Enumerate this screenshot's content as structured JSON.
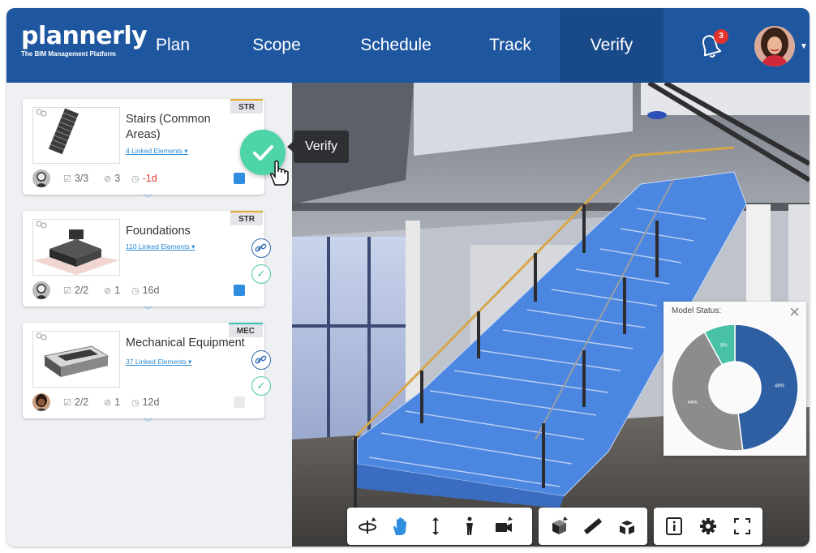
{
  "header": {
    "logo": "plannerly",
    "logo_tagline": "The BIM Management Platform",
    "nav": [
      "Plan",
      "Scope",
      "Schedule",
      "Track",
      "Verify"
    ],
    "active_nav": "Verify",
    "notifications_count": "3"
  },
  "cards": [
    {
      "title": "Stairs (Common Areas)",
      "linked": "4 Linked Elements ▾",
      "tag": "STR",
      "tasks": "3/3",
      "attachments": "3",
      "due": "-1d"
    },
    {
      "title": "Foundations",
      "linked": "110 Linked Elements ▾",
      "tag": "STR",
      "tasks": "2/2",
      "attachments": "1",
      "due": "16d"
    },
    {
      "title": "Mechanical Equipment",
      "linked": "37 Linked Elements ▾",
      "tag": "MEC",
      "tasks": "2/2",
      "attachments": "1",
      "due": "12d"
    }
  ],
  "tooltip": "Verify",
  "model_status": {
    "title": "Model Status:",
    "segments": [
      {
        "value": 48,
        "label": "48%",
        "color": "#2e5fa2"
      },
      {
        "value": 44,
        "label": "44%",
        "color": "#8c8c8c"
      },
      {
        "value": 8,
        "label": "8%",
        "color": "#48c1a7"
      }
    ]
  },
  "colors": {
    "header": "#1e579f",
    "accent_green": "#4dd4a8",
    "stair_blue": "#4b86e0"
  }
}
